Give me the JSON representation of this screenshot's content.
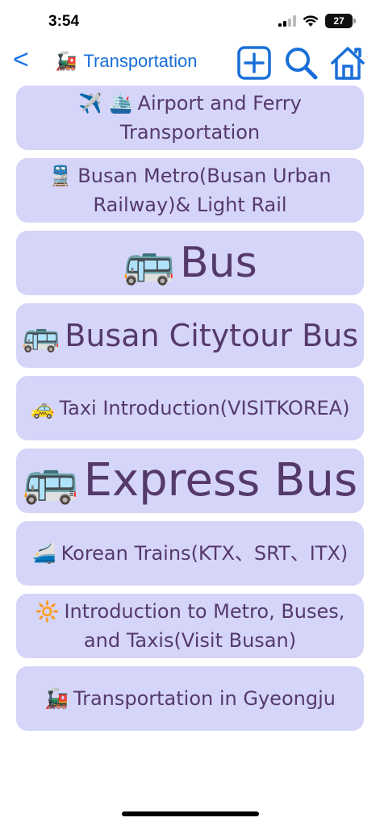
{
  "status": {
    "time": "3:54",
    "battery": "27"
  },
  "nav": {
    "back_label": "<",
    "title_icon": "🚂",
    "title": "Transportation",
    "actions": [
      "add-icon",
      "search-icon",
      "home-icon"
    ],
    "accent": "#1a6fd8"
  },
  "items": [
    {
      "icon": "✈️ 🛳️",
      "label": "Airport and Ferry Transportation",
      "size": "s"
    },
    {
      "icon": "🚆",
      "label": "Busan Metro(Busan Urban Railway)& Light Rail",
      "size": "s"
    },
    {
      "icon": "🚌",
      "label": "Bus",
      "size": "l"
    },
    {
      "icon": "🚌",
      "label": "Busan Citytour Bus",
      "size": "m"
    },
    {
      "icon": "🚕",
      "label": "Taxi Introduction(VISITKOREA)",
      "size": "s"
    },
    {
      "icon": "🚌",
      "label": "Express Bus",
      "size": "xl"
    },
    {
      "icon": "🚄",
      "label": "Korean Trains(KTX、SRT、ITX)",
      "size": "s"
    },
    {
      "icon": "🔆",
      "label": "Introduction to Metro, Buses, and Taxis(Visit Busan)",
      "size": "s"
    },
    {
      "icon": "🚂",
      "label": "Transportation in Gyeongju",
      "size": "s"
    }
  ],
  "colors": {
    "item_bg": "#d5d5f9",
    "item_text": "#553a69"
  }
}
